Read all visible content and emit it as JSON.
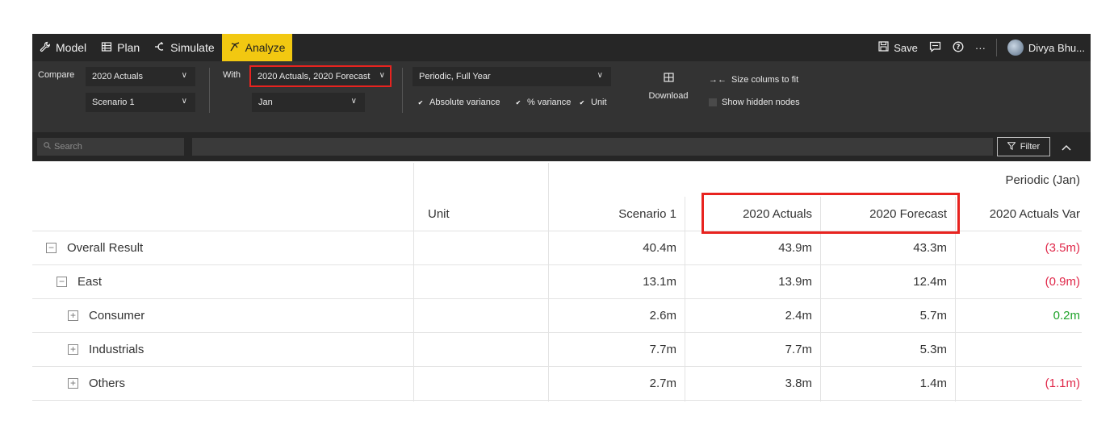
{
  "nav": {
    "tabs": [
      {
        "label": "Model",
        "icon": "wrench-icon"
      },
      {
        "label": "Plan",
        "icon": "table-icon"
      },
      {
        "label": "Simulate",
        "icon": "simulate-icon"
      },
      {
        "label": "Analyze",
        "icon": "analyze-icon",
        "active": true
      }
    ],
    "save_label": "Save",
    "user_name": "Divya Bhu...",
    "more_label": "···"
  },
  "ribbon": {
    "compare_label": "Compare",
    "compare_value": "2020 Actuals",
    "compare_scenario": "Scenario 1",
    "with_label": "With",
    "with_value": "2020 Actuals, 2020 Forecast",
    "with_period": "Jan",
    "period_value": "Periodic, Full Year",
    "checks": [
      {
        "label": "Absolute variance",
        "checked": true
      },
      {
        "label": "% variance",
        "checked": true
      },
      {
        "label": "Unit",
        "checked": true
      }
    ],
    "download_label": "Download",
    "size_columns_label": "Size colums to fit",
    "show_hidden_label": "Show hidden nodes"
  },
  "search": {
    "placeholder": "Search",
    "filter_label": "Filter"
  },
  "table": {
    "group_header": "Periodic (Jan)",
    "columns": [
      "Unit",
      "Scenario 1",
      "2020 Actuals",
      "2020 Forecast",
      "2020 Actuals Var"
    ],
    "rows": [
      {
        "label": "Overall Result",
        "toggle": "−",
        "unit": "",
        "scenario1": "40.4m",
        "actuals": "43.9m",
        "forecast": "43.3m",
        "var": "(3.5m)"
      },
      {
        "label": "East",
        "toggle": "−",
        "unit": "",
        "scenario1": "13.1m",
        "actuals": "13.9m",
        "forecast": "12.4m",
        "var": "(0.9m)"
      },
      {
        "label": "Consumer",
        "toggle": "+",
        "unit": "",
        "scenario1": "2.6m",
        "actuals": "2.4m",
        "forecast": "5.7m",
        "var": "0.2m"
      },
      {
        "label": "Industrials",
        "toggle": "+",
        "unit": "",
        "scenario1": "7.7m",
        "actuals": "7.7m",
        "forecast": "5.3m",
        "var": ""
      },
      {
        "label": "Others",
        "toggle": "+",
        "unit": "",
        "scenario1": "2.7m",
        "actuals": "3.8m",
        "forecast": "1.4m",
        "var": "(1.1m)"
      }
    ]
  },
  "colors": {
    "accent": "#f2c811",
    "highlight": "#e8231f",
    "negative": "#e0294a",
    "positive": "#1fa32a"
  }
}
